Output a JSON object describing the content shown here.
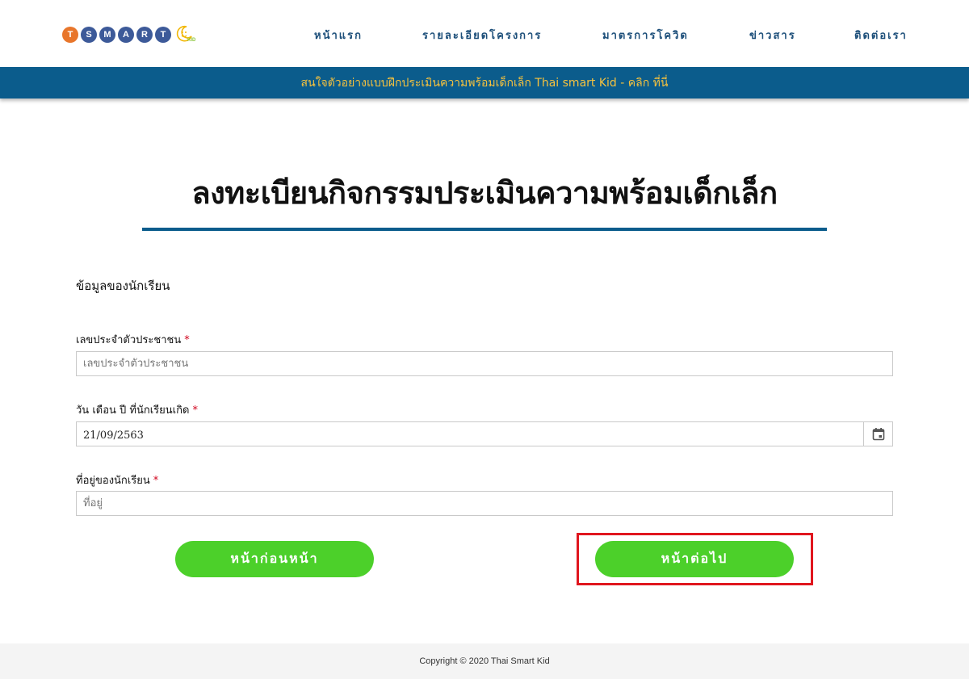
{
  "header": {
    "logo": {
      "letters": [
        {
          "char": "T",
          "color": "#e8762b"
        },
        {
          "char": "S",
          "color": "#3d5a99"
        },
        {
          "char": "M",
          "color": "#3d5a99"
        },
        {
          "char": "A",
          "color": "#3d5a99"
        },
        {
          "char": "R",
          "color": "#3d5a99"
        },
        {
          "char": "T",
          "color": "#3d5a99"
        }
      ],
      "kid_text": "KID",
      "kid_color": "#8dc63f",
      "smile_color": "#f2b705"
    },
    "nav": [
      {
        "label": "หน้าแรก"
      },
      {
        "label": "รายละเอียดโครงการ"
      },
      {
        "label": "มาตรการโควิด"
      },
      {
        "label": "ข่าวสาร"
      },
      {
        "label": "ติดต่อเรา"
      }
    ]
  },
  "announcement": {
    "text": "สนใจตัวอย่างแบบฝึกประเมินความพร้อมเด็กเล็ก Thai smart Kid - คลิก ที่นี่"
  },
  "page": {
    "title": "ลงทะเบียนกิจกรรมประเมินความพร้อมเด็กเล็ก",
    "section_heading": "ข้อมูลของนักเรียน"
  },
  "form": {
    "required_mark": "*",
    "id_card": {
      "label": "เลขประจำตัวประชาชน",
      "placeholder": "เลขประจำตัวประชาชน",
      "value": ""
    },
    "birth_date": {
      "label": "วัน เดือน ปี ที่นักเรียนเกิด",
      "value": "21/09/2563"
    },
    "address": {
      "label": "ที่อยู่ของนักเรียน",
      "placeholder": "ที่อยู่",
      "value": ""
    },
    "prev_button": "หน้าก่อนหน้า",
    "next_button": "หน้าต่อไป"
  },
  "footer": {
    "copyright": "Copyright © 2020 Thai Smart Kid"
  },
  "colors": {
    "nav_text": "#1d4f7a",
    "announce_bg": "#0b5c8c",
    "announce_text": "#f6c23e",
    "button_green": "#4cd02a",
    "highlight_red": "#e0161e",
    "required_red": "#d0021b"
  }
}
